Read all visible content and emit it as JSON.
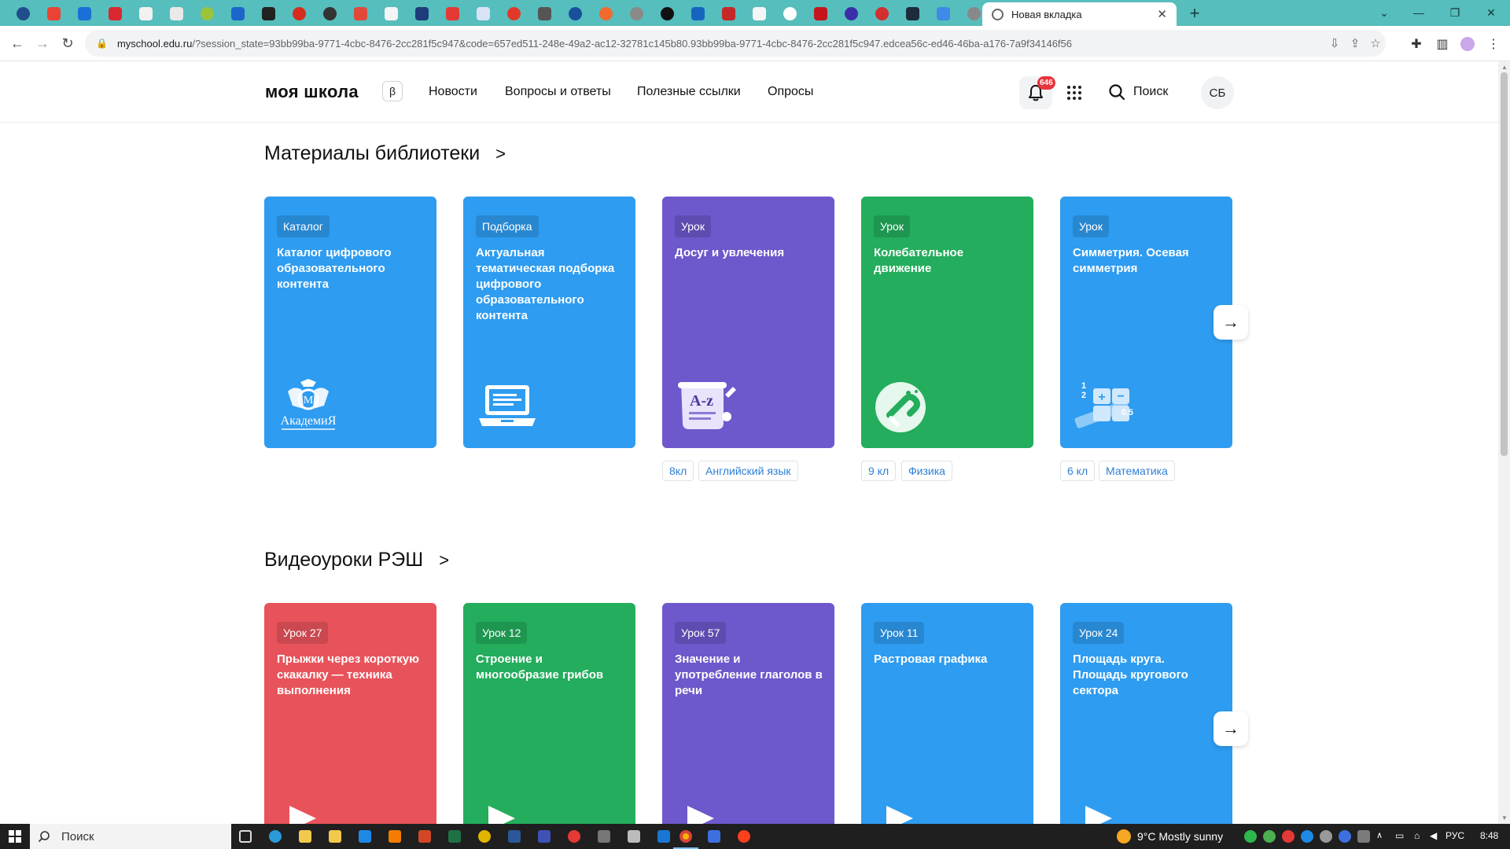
{
  "browser": {
    "active_tab_title": "Новая вкладка",
    "url_host": "myschool.edu.ru",
    "url_rest": "/?session_state=93bb99ba-9771-4cbc-8476-2cc281f5c947&code=657ed511-248e-49a2-ac12-32781c145b80.93bb99ba-9771-4cbc-8476-2cc281f5c947.edcea56c-ed46-46ba-a176-7a9f34146f56"
  },
  "site": {
    "logo": "моя школа",
    "beta": "β",
    "nav": [
      "Новости",
      "Вопросы и ответы",
      "Полезные ссылки",
      "Опросы"
    ],
    "notifications_count": "646",
    "search_label": "Поиск",
    "avatar_initials": "СБ"
  },
  "library": {
    "title": "Материалы библиотеки",
    "cards": [
      {
        "badge": "Каталог",
        "title": "Каталог цифрового образовательного контента",
        "color": "#2e9cf0",
        "icon": "academy-logo-icon"
      },
      {
        "badge": "Подборка",
        "title": "Актуальная тематическая подборка цифрового образовательного контента",
        "color": "#2e9cf0",
        "icon": "laptop-icon"
      },
      {
        "badge": "Урок",
        "title": "Досуг и увлечения",
        "color": "#6e58cb",
        "icon": "alphabet-scroll-icon",
        "tags": [
          "8кл",
          "Английский язык"
        ]
      },
      {
        "badge": "Урок",
        "title": "Колебательное движение",
        "color": "#23ad5c",
        "icon": "magnet-icon",
        "tags": [
          "9 кл",
          "Физика"
        ]
      },
      {
        "badge": "Урок",
        "title": "Симметрия. Осевая симметрия",
        "color": "#2e9cf0",
        "icon": "math-calculator-icon",
        "tags": [
          "6 кл",
          "Математика"
        ]
      }
    ]
  },
  "videos": {
    "title": "Видеоуроки РЭШ",
    "cards": [
      {
        "badge": "Урок 27",
        "title": "Прыжки через короткую скакалку — техника выполнения",
        "color": "#e8535b"
      },
      {
        "badge": "Урок 12",
        "title": "Строение и многообразие грибов",
        "color": "#23ad5c"
      },
      {
        "badge": "Урок 57",
        "title": "Значение и употребление глаголов в речи",
        "color": "#6e58cb"
      },
      {
        "badge": "Урок 11",
        "title": "Растровая графика",
        "color": "#2e9cf0"
      },
      {
        "badge": "Урок 24",
        "title": "Площадь круга. Площадь кругового сектора",
        "color": "#2e9cf0"
      }
    ]
  },
  "taskbar": {
    "search_label": "Поиск",
    "weather": "9°C  Mostly sunny",
    "lang": "РУС",
    "time": "8:48"
  }
}
